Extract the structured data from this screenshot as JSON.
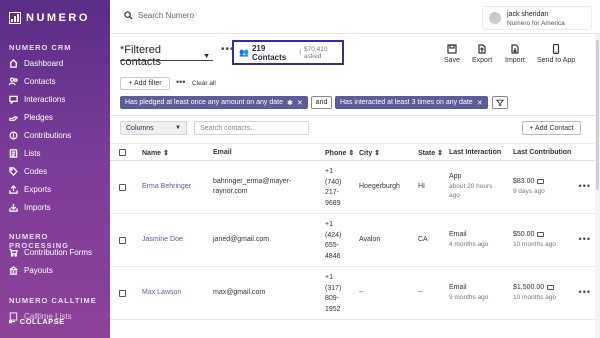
{
  "app": {
    "brand": "NUMERO"
  },
  "sidebar": {
    "sections": [
      {
        "title": "NUMERO CRM",
        "items": [
          "Dashboard",
          "Contacts",
          "Interactions",
          "Pledges",
          "Contributions",
          "Lists",
          "Codes",
          "Exports",
          "Imports"
        ]
      },
      {
        "title": "NUMERO PROCESSING",
        "items": [
          "Contribution Forms",
          "Payouts"
        ]
      },
      {
        "title": "NUMERO CALLTIME",
        "items": [
          "Calltime Lists"
        ]
      }
    ],
    "collapse_label": "COLLAPSE"
  },
  "topbar": {
    "search_placeholder": "Search Numero",
    "user_name": "jack sheridan",
    "user_org": "Numero for America"
  },
  "filterbar": {
    "view_name": "*Filtered contacts",
    "contacts_count": "219 Contacts",
    "asked": "$70,410 asked",
    "actions": [
      "Save",
      "Export",
      "Import",
      "Send to App"
    ],
    "add_filter": "+ Add filter",
    "clear_all": "Clear all",
    "chips": [
      "Has pledged at least once any amount on any date",
      "Has interacted at least 3 times on any date"
    ],
    "and_label": "and"
  },
  "table_controls": {
    "columns_label": "Columns",
    "search_placeholder": "Search contacts...",
    "add_contact": "+ Add Contact"
  },
  "table": {
    "headers": [
      "Name",
      "Email",
      "Phone",
      "City",
      "State",
      "Last Interaction",
      "Last Contribution"
    ],
    "rows": [
      {
        "name": "Erma Behringer",
        "email_line1": "bahringer_erma@mayer-",
        "email_line2": "raynor.com",
        "phone": [
          "+1",
          "(740)",
          "217-",
          "9689"
        ],
        "city": "Hoegerburgh",
        "state": "HI",
        "interaction": "App",
        "interaction_ago_1": "about 20 hours",
        "interaction_ago_2": "ago",
        "contribution": "$83.00",
        "contribution_ago": "9 days ago"
      },
      {
        "name": "Jasmine Doe",
        "email_line1": "janed@gmail.com",
        "email_line2": "",
        "phone": [
          "+1",
          "(424)",
          "655-",
          "4846"
        ],
        "city": "Avalon",
        "state": "CA",
        "interaction": "Email",
        "interaction_ago_1": "4 months ago",
        "interaction_ago_2": "",
        "contribution": "$50.00",
        "contribution_ago": "10 months ago"
      },
      {
        "name": "Max Lawson",
        "email_line1": "max@gmail.com",
        "email_line2": "",
        "phone": [
          "+1",
          "(317)",
          "809-",
          "1952"
        ],
        "city": "--",
        "state": "--",
        "interaction": "Email",
        "interaction_ago_1": "9 months ago",
        "interaction_ago_2": "",
        "contribution": "$1,500.00",
        "contribution_ago": "10 months ago"
      }
    ]
  }
}
